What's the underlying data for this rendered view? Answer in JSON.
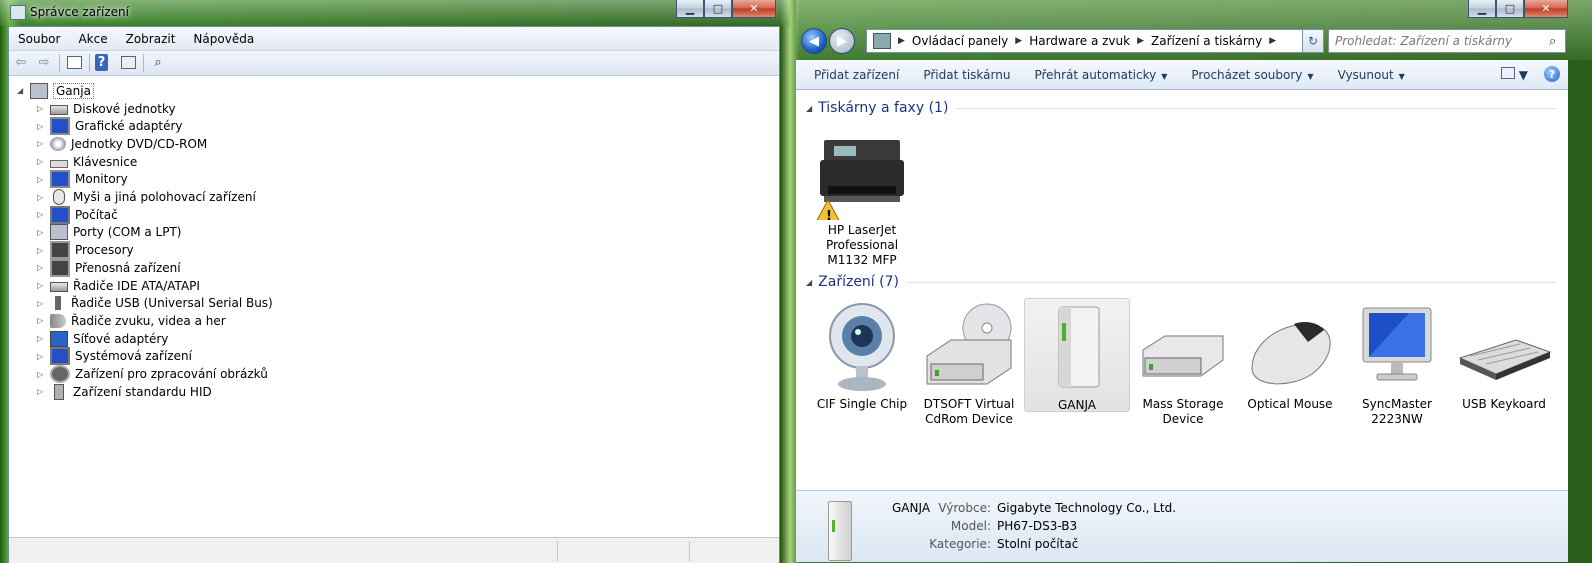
{
  "device_manager": {
    "title": "Správce zařízení",
    "menu": [
      "Soubor",
      "Akce",
      "Zobrazit",
      "Nápověda"
    ],
    "root": "Ganja",
    "items": [
      {
        "label": "Diskové jednotky",
        "icon": "disk-drive-icon"
      },
      {
        "label": "Grafické adaptéry",
        "icon": "display-adapter-icon"
      },
      {
        "label": "Jednotky DVD/CD-ROM",
        "icon": "dvd-drive-icon"
      },
      {
        "label": "Klávesnice",
        "icon": "keyboard-icon"
      },
      {
        "label": "Monitory",
        "icon": "monitor-icon"
      },
      {
        "label": "Myši a jiná polohovací zařízení",
        "icon": "mouse-icon"
      },
      {
        "label": "Počítač",
        "icon": "computer-icon"
      },
      {
        "label": "Porty (COM a LPT)",
        "icon": "port-icon"
      },
      {
        "label": "Procesory",
        "icon": "processor-icon"
      },
      {
        "label": "Přenosná zařízení",
        "icon": "portable-device-icon"
      },
      {
        "label": "Řadiče IDE ATA/ATAPI",
        "icon": "ide-controller-icon"
      },
      {
        "label": "Řadiče USB (Universal Serial Bus)",
        "icon": "usb-controller-icon"
      },
      {
        "label": "Řadiče zvuku, videa a her",
        "icon": "sound-icon"
      },
      {
        "label": "Síťové adaptéry",
        "icon": "network-adapter-icon"
      },
      {
        "label": "Systémová zařízení",
        "icon": "system-device-icon"
      },
      {
        "label": "Zařízení pro zpracování obrázků",
        "icon": "imaging-device-icon"
      },
      {
        "label": "Zařízení standardu HID",
        "icon": "hid-icon"
      }
    ]
  },
  "devices_printers": {
    "breadcrumb": [
      "Ovládací panely",
      "Hardware a zvuk",
      "Zařízení a tiskárny"
    ],
    "search_placeholder": "Prohledat: Zařízení a tiskárny",
    "commands": [
      {
        "label": "Přidat zařízení",
        "dropdown": false
      },
      {
        "label": "Přidat tiskárnu",
        "dropdown": false
      },
      {
        "label": "Přehrát automaticky",
        "dropdown": true
      },
      {
        "label": "Procházet soubory",
        "dropdown": true
      },
      {
        "label": "Vysunout",
        "dropdown": true
      }
    ],
    "printers_header": "Tiskárny a faxy (1)",
    "printers": [
      {
        "label": "HP LaserJet Professional M1132 MFP",
        "icon": "printer-icon",
        "warning": true
      }
    ],
    "devices_header": "Zařízení (7)",
    "devices": [
      {
        "label": "CIF Single Chip",
        "icon": "webcam-icon"
      },
      {
        "label": "DTSOFT Virtual CdRom Device",
        "icon": "cdrom-icon"
      },
      {
        "label": "GANJA",
        "icon": "computer-tower-icon",
        "selected": true
      },
      {
        "label": "Mass Storage Device",
        "icon": "storage-drive-icon"
      },
      {
        "label": "Optical Mouse",
        "icon": "mouse-icon"
      },
      {
        "label": "SyncMaster 2223NW",
        "icon": "monitor-icon"
      },
      {
        "label": "USB Keykoard",
        "icon": "keyboard-icon"
      }
    ],
    "details": {
      "name": "GANJA",
      "rows": [
        {
          "key": "Výrobce:",
          "value": "Gigabyte Technology Co., Ltd."
        },
        {
          "key": "Model:",
          "value": "PH67-DS3-B3"
        },
        {
          "key": "Kategorie:",
          "value": "Stolní počítač"
        }
      ]
    }
  }
}
